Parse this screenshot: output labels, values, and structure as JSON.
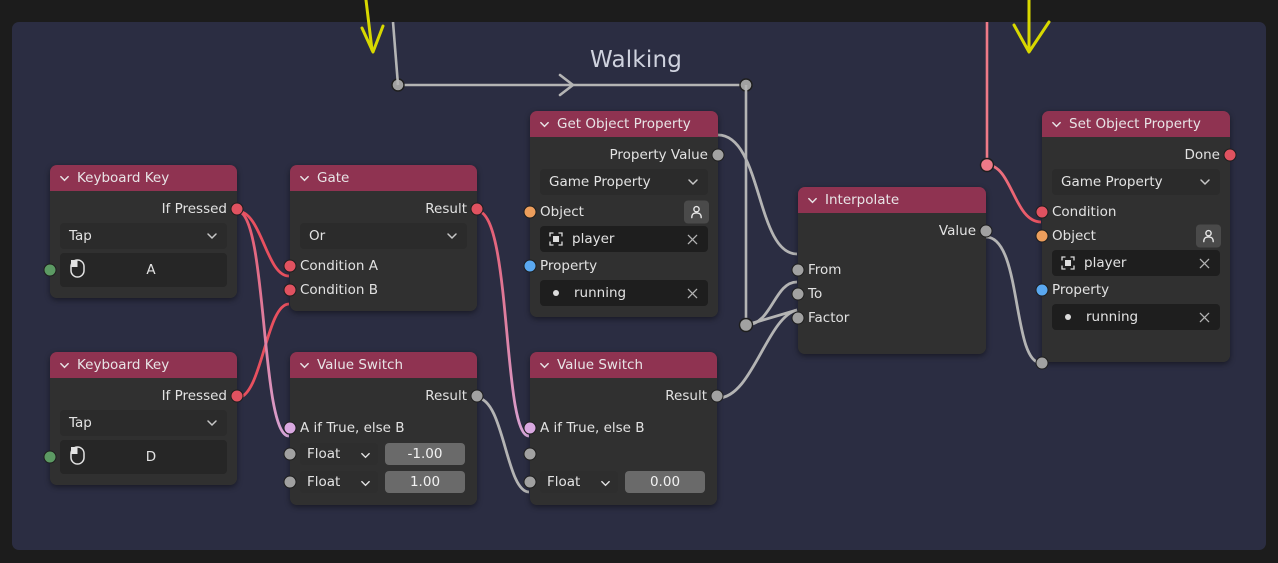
{
  "frame": {
    "label": "Walking"
  },
  "colors": {
    "canvas_bg": "#2b2d42",
    "node_body": "#303030",
    "node_header": "#8f3351",
    "socket_red": "#e05260",
    "socket_grey": "#a1a1a1",
    "socket_orange": "#ed9e5c",
    "socket_blue": "#5aa8f0",
    "socket_green": "#5c9a63",
    "socket_violet": "#d9a8e0",
    "link_red": "#e8505f",
    "link_grey": "#b4b4b4",
    "link_violet": "#d6aadd",
    "annotation": "#d8d800"
  },
  "nodes": {
    "keyboard_key_a": {
      "title": "Keyboard Key",
      "output_label": "If Pressed",
      "mode": "Tap",
      "key": "A",
      "key_icon": "keyboard-icon"
    },
    "keyboard_key_d": {
      "title": "Keyboard Key",
      "output_label": "If Pressed",
      "mode": "Tap",
      "key": "D",
      "key_icon": "keyboard-icon"
    },
    "gate": {
      "title": "Gate",
      "output_label": "Result",
      "operation": "Or",
      "input_a": "Condition A",
      "input_b": "Condition B"
    },
    "value_switch_1": {
      "title": "Value Switch",
      "output_label": "Result",
      "condition_label": "A if True, else B",
      "a_type": "Float",
      "a_value": "-1.00",
      "b_type": "Float",
      "b_value": "1.00"
    },
    "value_switch_2": {
      "title": "Value Switch",
      "output_label": "Result",
      "condition_label": "A if True, else B",
      "b_type": "Float",
      "b_value": "0.00"
    },
    "get_object_property": {
      "title": "Get Object Property",
      "output_label": "Property Value",
      "mode": "Game Property",
      "object_label": "Object",
      "object_value": "player",
      "object_icon": "object-picker-icon",
      "object_value_icon": "object-icon",
      "property_label": "Property",
      "property_value": "running",
      "property_value_icon": "dot-icon",
      "clear_icon": "close-icon"
    },
    "interpolate": {
      "title": "Interpolate",
      "output_label": "Value",
      "input_from": "From",
      "input_to": "To",
      "input_factor": "Factor"
    },
    "set_object_property": {
      "title": "Set Object Property",
      "output_label": "Done",
      "mode": "Game Property",
      "condition_label": "Condition",
      "object_label": "Object",
      "object_value": "player",
      "object_icon": "object-picker-icon",
      "object_value_icon": "object-icon",
      "property_label": "Property",
      "property_value": "running",
      "property_value_icon": "dot-icon",
      "clear_icon": "close-icon"
    }
  }
}
